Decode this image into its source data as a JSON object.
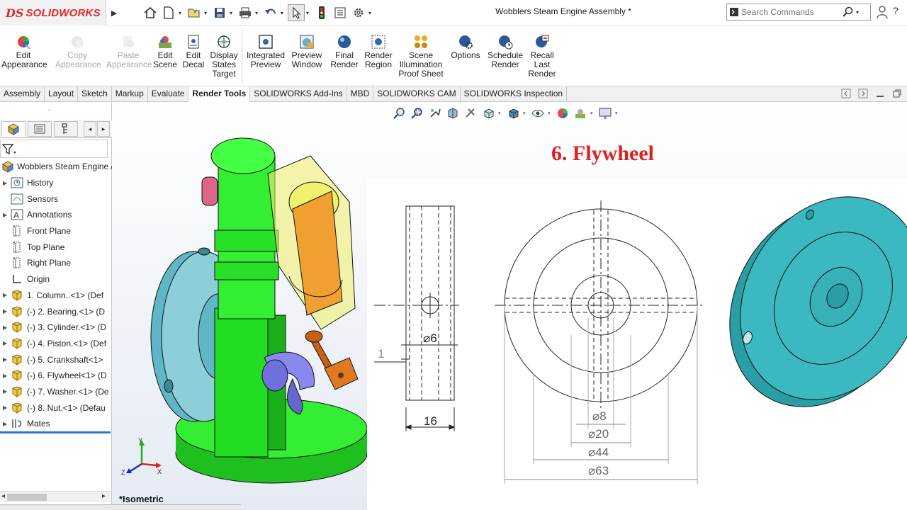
{
  "app": {
    "logo_prefix": "DS",
    "logo_name": "SOLIDWORKS"
  },
  "window": {
    "title": "Wobblers Steam Engine Assembly *"
  },
  "search": {
    "placeholder": "Search Commands"
  },
  "ribbon": {
    "buttons": [
      {
        "label": "Edit\nAppearance",
        "enabled": true,
        "icon": "edit-appearance-icon"
      },
      {
        "label": "Copy\nAppearance",
        "enabled": false,
        "icon": "copy-appearance-icon"
      },
      {
        "label": "Paste\nAppearance",
        "enabled": false,
        "icon": "paste-appearance-icon"
      },
      {
        "label": "Edit\nScene",
        "enabled": true,
        "icon": "edit-scene-icon"
      },
      {
        "label": "Edit\nDecal",
        "enabled": true,
        "icon": "edit-decal-icon"
      },
      {
        "label": "Display\nStates\nTarget",
        "enabled": true,
        "icon": "display-states-icon"
      },
      {
        "label": "Integrated\nPreview",
        "enabled": true,
        "icon": "integrated-preview-icon"
      },
      {
        "label": "Preview\nWindow",
        "enabled": true,
        "icon": "preview-window-icon"
      },
      {
        "label": "Final\nRender",
        "enabled": true,
        "icon": "final-render-icon"
      },
      {
        "label": "Render\nRegion",
        "enabled": true,
        "icon": "render-region-icon"
      },
      {
        "label": "Scene\nIllumination\nProof Sheet",
        "enabled": true,
        "icon": "scene-illumination-icon"
      },
      {
        "label": "Options",
        "enabled": true,
        "icon": "options-icon"
      },
      {
        "label": "Schedule\nRender",
        "enabled": true,
        "icon": "schedule-render-icon"
      },
      {
        "label": "Recall\nLast\nRender",
        "enabled": true,
        "icon": "recall-render-icon"
      }
    ]
  },
  "tabs": [
    {
      "label": "Assembly",
      "active": false
    },
    {
      "label": "Layout",
      "active": false
    },
    {
      "label": "Sketch",
      "active": false
    },
    {
      "label": "Markup",
      "active": false
    },
    {
      "label": "Evaluate",
      "active": false
    },
    {
      "label": "Render Tools",
      "active": true
    },
    {
      "label": "SOLIDWORKS Add-Ins",
      "active": false
    },
    {
      "label": "MBD",
      "active": false
    },
    {
      "label": "SOLIDWORKS CAM",
      "active": false
    },
    {
      "label": "SOLIDWORKS Inspection",
      "active": false
    }
  ],
  "tree": {
    "root": "Wobblers Steam Engine A",
    "items": [
      {
        "label": "History",
        "expandable": true,
        "icon": "history-icon"
      },
      {
        "label": "Sensors",
        "expandable": false,
        "icon": "sensors-icon"
      },
      {
        "label": "Annotations",
        "expandable": true,
        "icon": "annotations-icon"
      },
      {
        "label": "Front Plane",
        "expandable": false,
        "icon": "plane-icon"
      },
      {
        "label": "Top Plane",
        "expandable": false,
        "icon": "plane-icon"
      },
      {
        "label": "Right Plane",
        "expandable": false,
        "icon": "plane-icon"
      },
      {
        "label": "Origin",
        "expandable": false,
        "icon": "origin-icon"
      },
      {
        "label": "1. Column..<1> (Def",
        "expandable": true,
        "icon": "part-icon"
      },
      {
        "label": "(-) 2. Bearing.<1> (D",
        "expandable": true,
        "icon": "part-icon"
      },
      {
        "label": "(-) 3. Cylinder.<1> (D",
        "expandable": true,
        "icon": "part-icon"
      },
      {
        "label": "(-) 4. Piston.<1> (Def",
        "expandable": true,
        "icon": "part-icon"
      },
      {
        "label": "(-) 5. Crankshaft<1>",
        "expandable": true,
        "icon": "part-icon"
      },
      {
        "label": "(-) 6. Flywheel<1> (D",
        "expandable": true,
        "icon": "part-icon"
      },
      {
        "label": "(-) 7. Washer.<1> (De",
        "expandable": true,
        "icon": "part-icon"
      },
      {
        "label": "(-) 8. Nut.<1> (Defau",
        "expandable": true,
        "icon": "part-icon"
      },
      {
        "label": "Mates",
        "expandable": true,
        "icon": "mates-icon"
      }
    ]
  },
  "viewport": {
    "title": "6. Flywheel",
    "view_label": "*Isometric",
    "dimensions": {
      "side_width": "16",
      "hole_dia": "6",
      "offset": "1",
      "bore": "8",
      "hub": "20",
      "recess": "44",
      "outer": "63"
    },
    "axis_labels": {
      "x": "X",
      "y": "Y",
      "z": "Z"
    }
  },
  "colors": {
    "accent_red": "#e02020",
    "part_teal": "#3cb8c0",
    "part_green": "#33ee33",
    "brand_red": "#e8262b"
  }
}
